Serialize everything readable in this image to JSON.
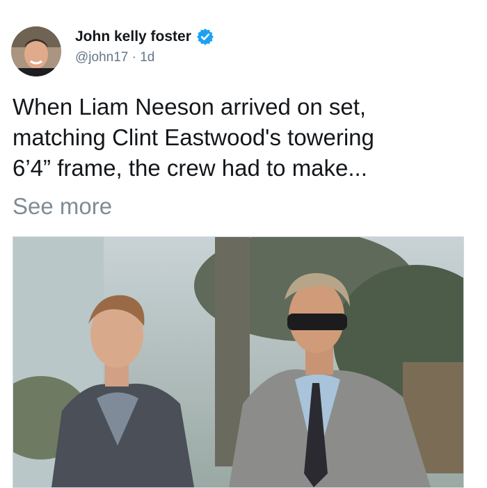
{
  "tweet": {
    "author_name": "John kelly foster",
    "handle": "@john17",
    "separator": "·",
    "timestamp": "1d",
    "text": "When Liam Neeson arrived on set,\nmatching Clint Eastwood's towering\n6’4” frame, the crew had to make...",
    "see_more": "See more"
  },
  "icons": {
    "verified": "verified-badge-icon",
    "avatar": "profile-photo"
  },
  "colors": {
    "verified_blue": "#1da1f2",
    "text": "#14171a",
    "secondary": "#657786",
    "see_more": "#808b94"
  }
}
